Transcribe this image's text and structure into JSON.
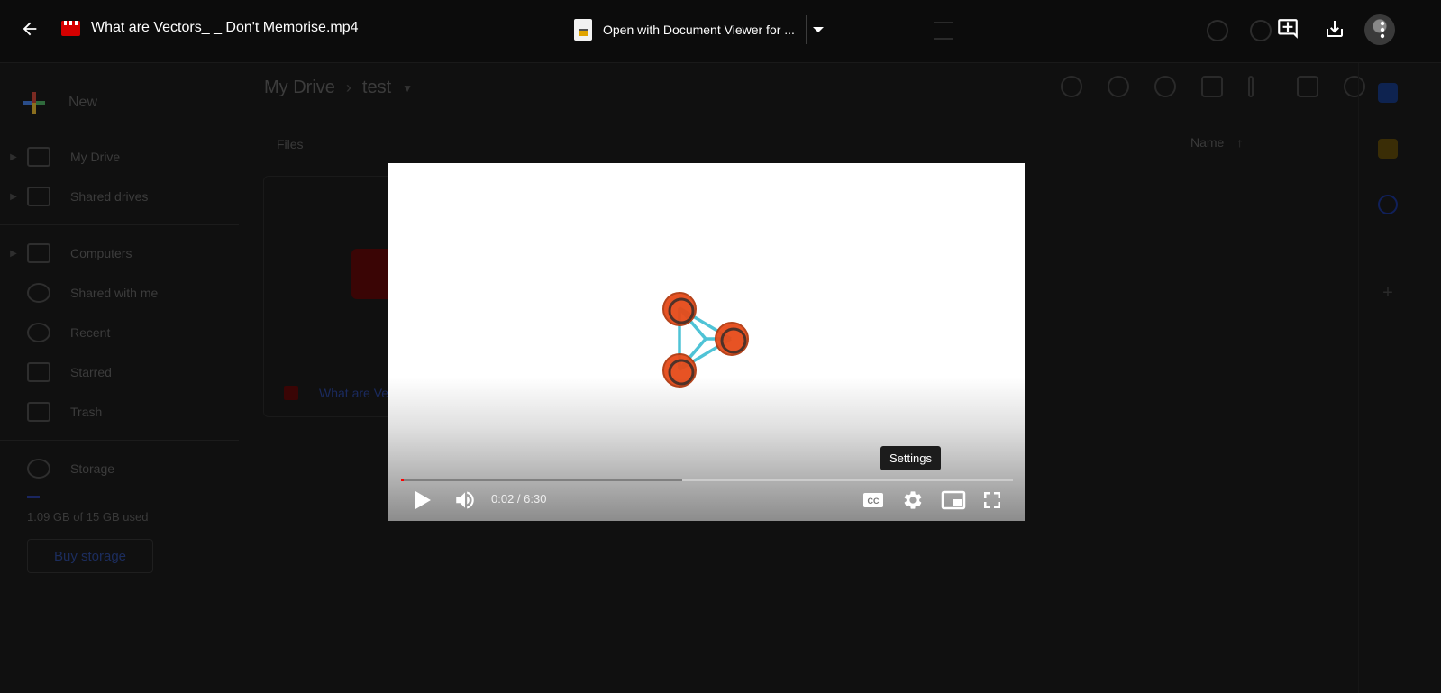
{
  "viewer": {
    "file_title": "What are Vectors_ _ Don't Memorise.mp4",
    "open_with_label": "Open with Document Viewer for ...",
    "icons": {
      "back": "arrow-left-icon",
      "file_type": "video-file-icon",
      "open_with_app": "document-viewer-icon",
      "open_with_dropdown": "caret-down-icon",
      "add_comment": "add-comment-icon",
      "download": "download-icon",
      "more": "more-vert-icon"
    }
  },
  "player": {
    "current_time": "0:02",
    "duration": "6:30",
    "time_display": "0:02 / 6:30",
    "played_fraction": 0.005,
    "buffered_fraction": 0.46,
    "tooltip": "Settings",
    "controls": {
      "play": "play-icon",
      "volume": "volume-icon",
      "captions": "cc-icon",
      "settings": "gear-icon",
      "miniplayer": "miniplayer-icon",
      "fullscreen": "fullscreen-icon"
    },
    "colors": {
      "played": "#ff0000",
      "logo_node": "#e64a19",
      "logo_edge": "#4fc3d6"
    }
  },
  "drive_background": {
    "new_label": "New",
    "nav": [
      {
        "label": "My Drive",
        "icon": "my-drive-icon"
      },
      {
        "label": "Shared drives",
        "icon": "shared-drives-icon"
      },
      {
        "label": "Computers",
        "icon": "computers-icon"
      },
      {
        "label": "Shared with me",
        "icon": "people-icon"
      },
      {
        "label": "Recent",
        "icon": "clock-icon"
      },
      {
        "label": "Starred",
        "icon": "star-icon"
      },
      {
        "label": "Trash",
        "icon": "trash-icon"
      },
      {
        "label": "Storage",
        "icon": "cloud-icon"
      }
    ],
    "storage_text": "1.09 GB of 15 GB used",
    "buy_storage": "Buy storage",
    "breadcrumb": {
      "root": "My Drive",
      "current": "test"
    },
    "files_label": "Files",
    "sort_label": "Name",
    "file_card_name": "What are Ve"
  }
}
